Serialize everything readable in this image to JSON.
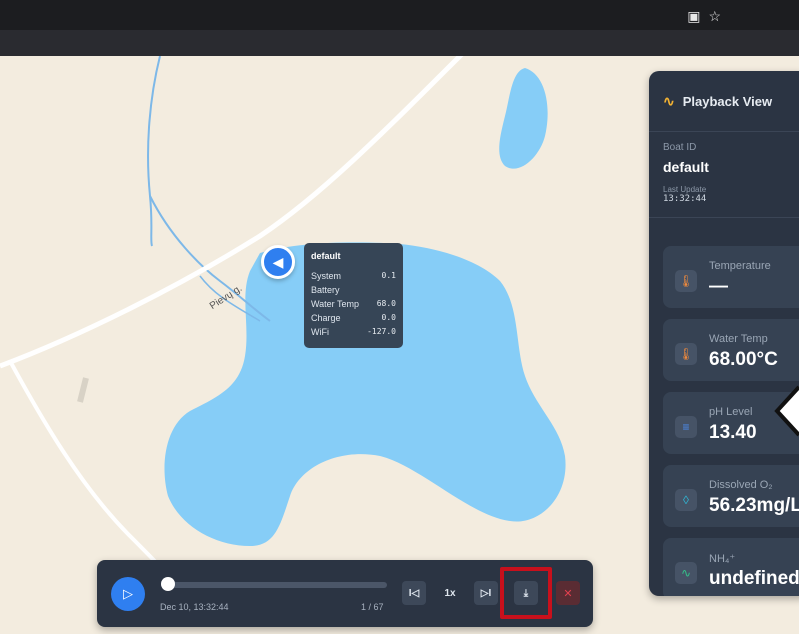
{
  "browser": {
    "icons": [
      "download-box-icon",
      "star-icon"
    ]
  },
  "map": {
    "road_label": "Pievų g."
  },
  "boat_tooltip": {
    "title": "default",
    "rows": [
      {
        "label": "System Battery",
        "value": "0.1"
      },
      {
        "label": "Water Temp",
        "value": "68.0"
      },
      {
        "label": "Charge",
        "value": "0.0"
      },
      {
        "label": "WiFi",
        "value": "-127.0"
      }
    ]
  },
  "panel": {
    "title": "Playback View",
    "boat_id_label": "Boat ID",
    "boat_id": "default",
    "last_update_label": "Last Update",
    "last_update": "13:32:44",
    "metrics": [
      {
        "label": "Temperature",
        "value": "—",
        "icon": "thermometer-icon",
        "color": "#f08a3c"
      },
      {
        "label": "Water Temp",
        "value": "68.00°C",
        "icon": "thermometer-icon",
        "color": "#f08a3c"
      },
      {
        "label": "pH Level",
        "value": "13.40",
        "icon": "ph-lines-icon",
        "color": "#4c8cf0"
      },
      {
        "label": "Dissolved O₂",
        "value": "56.23mg/L",
        "icon": "droplet-icon",
        "color": "#2fb7d6"
      },
      {
        "label": "NH₄⁺",
        "value": "undefined",
        "icon": "pulse-icon",
        "color": "#34c28a"
      }
    ]
  },
  "playback": {
    "time": "Dec 10, 13:32:44",
    "count": "1 / 67",
    "progress": 0,
    "speed": "1x",
    "prev_label": "I◁",
    "next_label": "▷I"
  },
  "colors": {
    "accent": "#2f7ff0",
    "water": "#86cdf7",
    "highlight": "#c8101c"
  }
}
